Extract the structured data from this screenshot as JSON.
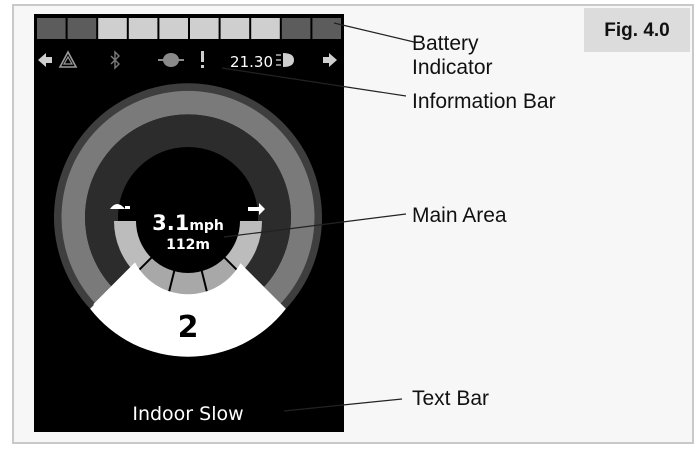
{
  "figure": {
    "tag": "Fig. 4.0",
    "callouts": {
      "battery": [
        "Battery",
        "Indicator"
      ],
      "information_bar": "Information Bar",
      "main_area": "Main Area",
      "text_bar": "Text Bar"
    }
  },
  "screen": {
    "info_bar": {
      "left_arrow_icon": "arrow-left-icon",
      "warning_icon": "warning-triangle-icon",
      "bluetooth_icon": "bluetooth-icon",
      "actuator_icon": "actuator-icon",
      "alert_icon": "exclamation-icon",
      "clock": "21.30",
      "lights_icon": "headlight-icon",
      "right_arrow_icon": "arrow-right-icon"
    },
    "main": {
      "speed_value": "3.1",
      "speed_unit": "mph",
      "distance": "112m",
      "profile_number": "2",
      "left_mode_icon": "turtle-icon",
      "right_mode_icon": "rabbit-icon"
    },
    "text_bar": "Indoor Slow"
  },
  "battery": {
    "segments_total": 10,
    "segments_lit": 6,
    "lit_color": "#cfcfcf",
    "unlit_color": "#5c5c5c"
  },
  "colors": {
    "screen_bg": "#000000",
    "outer_ring": "#3e3e3e",
    "mid_ring": "#7a7a7a",
    "inner_ring": "#2c2c2c",
    "speed_arc": "#bcbcbc",
    "profile_sector": "#ffffff"
  }
}
